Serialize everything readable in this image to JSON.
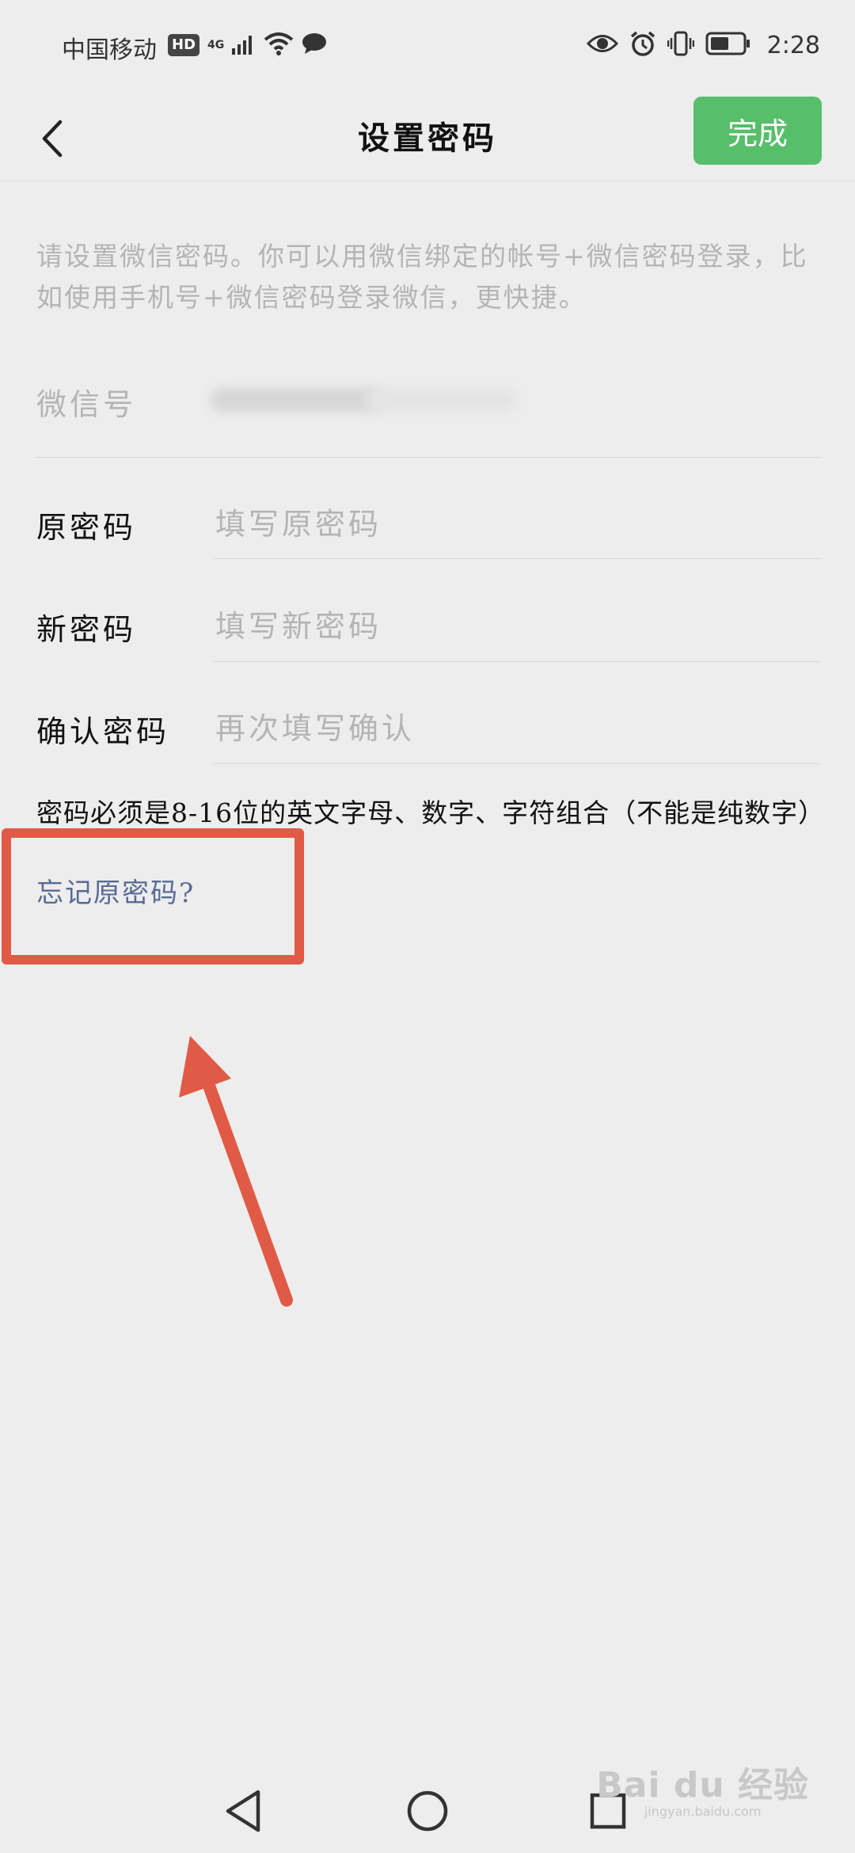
{
  "status_bar": {
    "carrier": "中国移动",
    "hd": "HD",
    "network": "4G",
    "time": "2:28",
    "icons": [
      "hd-icon",
      "signal-icon",
      "wifi-icon",
      "chat-bubble-icon",
      "eye-icon",
      "alarm-icon",
      "vibrate-icon",
      "battery-icon"
    ]
  },
  "nav": {
    "back_icon": "chevron-left-icon",
    "title": "设置密码",
    "done_label": "完成",
    "done_color": "#57be6a"
  },
  "description": "请设置微信密码。你可以用微信绑定的帐号+微信密码登录，比如使用手机号+微信密码登录微信，更快捷。",
  "wechat_id": {
    "label": "微信号"
  },
  "fields": [
    {
      "label": "原密码",
      "placeholder": "填写原密码",
      "value": ""
    },
    {
      "label": "新密码",
      "placeholder": "填写新密码",
      "value": ""
    },
    {
      "label": "确认密码",
      "placeholder": "再次填写确认",
      "value": ""
    }
  ],
  "rule_text": "密码必须是8-16位的英文字母、数字、字符组合（不能是纯数字）",
  "forgot_link": "忘记原密码?",
  "link_color": "#576b95",
  "annotation_color": "#e05a45",
  "system_nav": [
    "back-triangle-icon",
    "home-circle-icon",
    "recents-square-icon"
  ],
  "watermark": {
    "main": "Bai du 经验",
    "sub": "jingyan.baidu.com"
  }
}
